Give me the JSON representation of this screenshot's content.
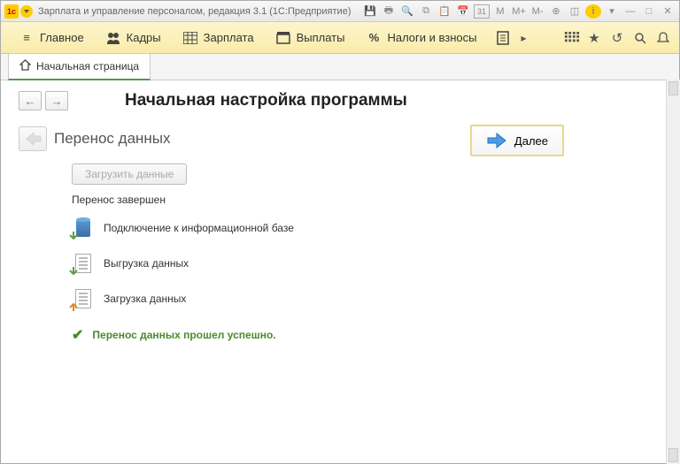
{
  "window": {
    "title": "Зарплата и управление персоналом, редакция 3.1  (1С:Предприятие)"
  },
  "titlebar_controls": {
    "calc": "M",
    "calc_plus": "M+",
    "calc_minus": "M-"
  },
  "nav": {
    "main": "Главное",
    "kadry": "Кадры",
    "zarplata": "Зарплата",
    "vyplaty": "Выплаты",
    "nalogi": "Налоги и взносы"
  },
  "tabs": {
    "home": "Начальная страница"
  },
  "page": {
    "title": "Начальная настройка программы",
    "wizard_title": "Перенос данных",
    "next": "Далее",
    "load_button": "Загрузить данные",
    "status": "Перенос завершен",
    "step1": "Подключение к информационной базе",
    "step2": "Выгрузка данных",
    "step3": "Загрузка данных",
    "success": "Перенос данных прошел успешно."
  }
}
